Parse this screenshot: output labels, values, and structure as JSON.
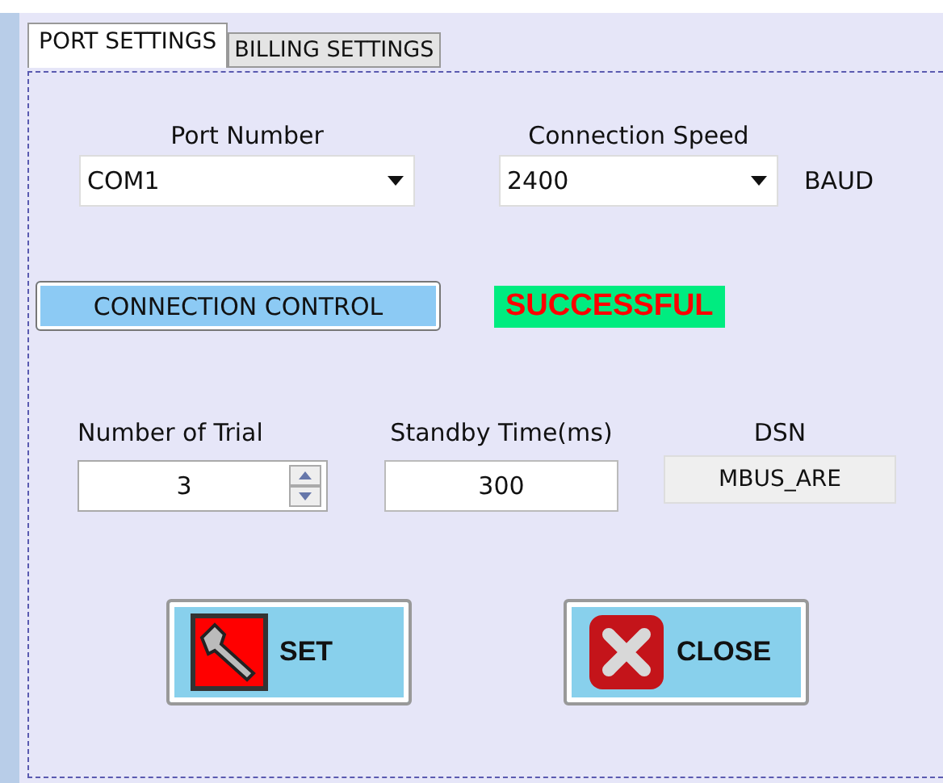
{
  "tabs": [
    {
      "label": "PORT SETTINGS",
      "selected": true
    },
    {
      "label": "BILLING SETTINGS",
      "selected": false
    }
  ],
  "port_number": {
    "label": "Port Number",
    "value": "COM1"
  },
  "connection_speed": {
    "label": "Connection Speed",
    "value": "2400",
    "unit": "BAUD"
  },
  "connection_control": {
    "label": "CONNECTION CONTROL"
  },
  "status": {
    "text": "SUCCESSFUL"
  },
  "number_of_trial": {
    "label": "Number of Trial",
    "value": "3"
  },
  "standby_time": {
    "label": "Standby Time(ms)",
    "value": "300"
  },
  "dsn": {
    "label": "DSN",
    "value": "MBUS_ARE"
  },
  "buttons": [
    {
      "label": "SET",
      "kind": "set"
    },
    {
      "label": "CLOSE",
      "kind": "close"
    }
  ]
}
